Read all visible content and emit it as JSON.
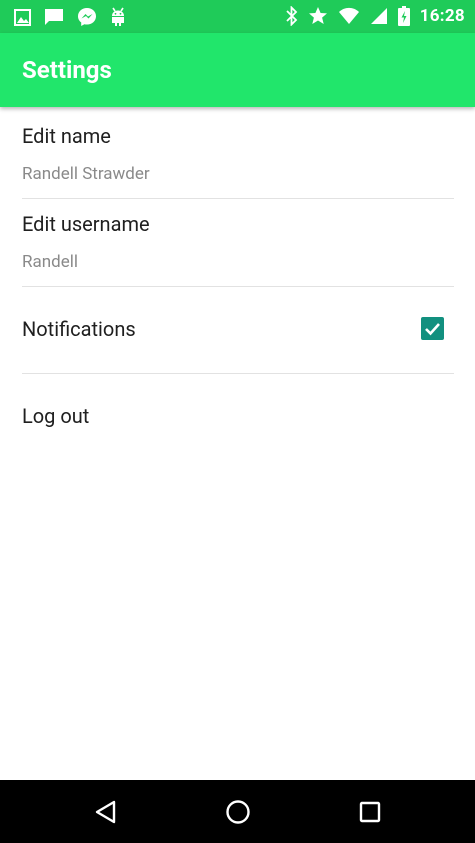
{
  "status_bar": {
    "time": "16:28",
    "left_icons": [
      "gallery-icon",
      "message-icon",
      "messenger-icon",
      "android-icon"
    ],
    "right_icons": [
      "bluetooth-icon",
      "star-icon",
      "wifi-icon",
      "cell-signal-icon",
      "battery-icon"
    ]
  },
  "app_bar": {
    "title": "Settings"
  },
  "settings": {
    "edit_name": {
      "title": "Edit name",
      "summary": "Randell Strawder"
    },
    "edit_username": {
      "title": "Edit username",
      "summary": "Randell"
    },
    "notifications": {
      "title": "Notifications",
      "checked": true
    },
    "log_out": {
      "title": "Log out"
    }
  },
  "nav_bar": {
    "buttons": [
      "back-icon",
      "home-icon",
      "recents-icon"
    ]
  },
  "colors": {
    "status_bar": "#1fcb59",
    "app_bar": "#21e66b",
    "checkbox": "#12907f"
  }
}
